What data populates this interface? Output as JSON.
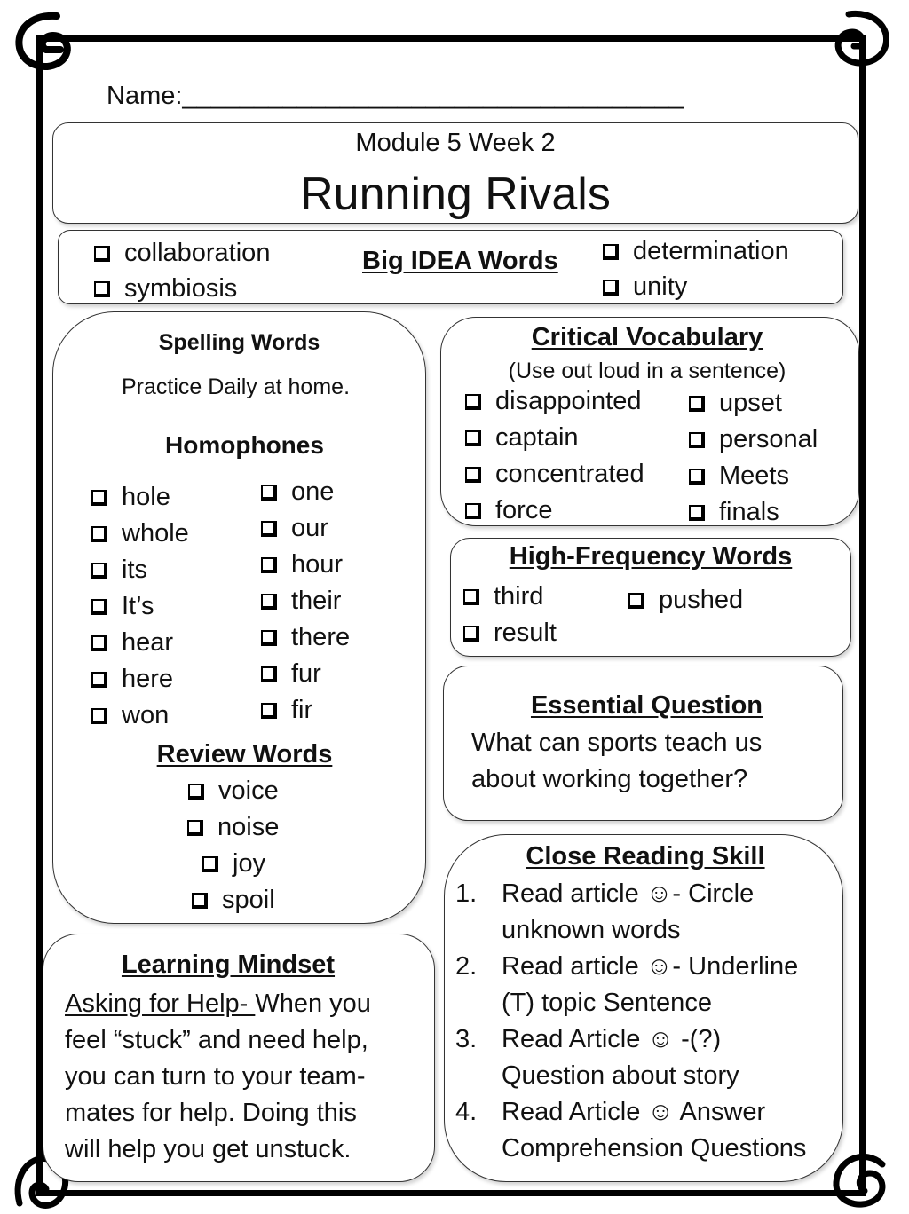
{
  "header": {
    "name_label": "Name:",
    "name_blank": "___________________________________",
    "module": "Module 5 Week 2",
    "title": "Running Rivals"
  },
  "big_idea": {
    "heading": "Big IDEA Words",
    "left": [
      "collaboration",
      "symbiosis"
    ],
    "right": [
      "determination",
      "unity"
    ]
  },
  "spelling": {
    "heading": "Spelling Words",
    "subtitle": "Practice Daily at home.",
    "homophones_heading": "Homophones",
    "col1": [
      "hole",
      "whole",
      "its",
      "It’s",
      "hear",
      "here",
      "won"
    ],
    "col2": [
      "one",
      "our",
      "hour",
      "their",
      "there",
      "fur",
      "fir"
    ],
    "review_heading": "Review Words",
    "review": [
      "voice",
      "noise",
      "joy",
      "spoil"
    ]
  },
  "critical_vocab": {
    "heading": "Critical Vocabulary",
    "subtitle": "(Use out loud in a sentence)",
    "col1": [
      "disappointed",
      "captain",
      "concentrated",
      "force"
    ],
    "col2": [
      "upset",
      "personal",
      "Meets",
      "finals"
    ]
  },
  "high_frequency": {
    "heading": "High-Frequency Words",
    "col1": [
      "third",
      "result"
    ],
    "col2": [
      "pushed"
    ]
  },
  "essential_question": {
    "heading": "Essential Question",
    "line1": "What can sports teach us",
    "line2": "about working together?"
  },
  "close_reading": {
    "heading": "Close Reading Skill",
    "items": [
      {
        "num": "1.",
        "line1": "Read article ☺- Circle",
        "line2": "unknown words"
      },
      {
        "num": "2.",
        "line1": "Read article ☺-  Underline",
        "line2": "(T) topic Sentence"
      },
      {
        "num": "3.",
        "line1": "Read Article ☺ -(?)",
        "line2": "Question about story"
      },
      {
        "num": "4.",
        "line1": "Read Article ☺ Answer",
        "line2": "Comprehension Questions"
      }
    ]
  },
  "learning_mindset": {
    "heading": "Learning Mindset",
    "lead": "Asking for Help- ",
    "lines": [
      "When you",
      "feel “stuck” and need help,",
      "you can turn to your team-",
      "mates for help. Doing this",
      "will help you get unstuck."
    ]
  }
}
